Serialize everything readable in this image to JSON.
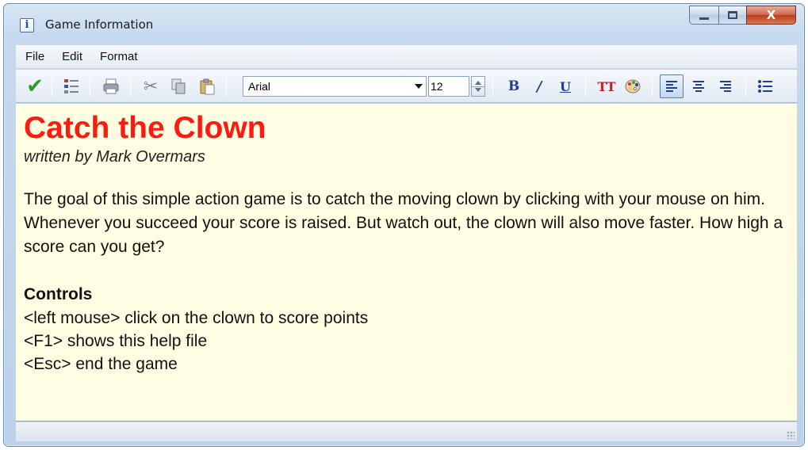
{
  "window": {
    "title": "Game Information",
    "controls": {
      "minimize": "minimize",
      "maximize": "maximize",
      "close": "X"
    }
  },
  "menubar": {
    "items": [
      "File",
      "Edit",
      "Format"
    ]
  },
  "toolbar": {
    "font_name": "Arial",
    "font_size": "12",
    "icons": [
      "check-icon",
      "list-icon",
      "print-icon",
      "cut-icon",
      "copy-icon",
      "paste-icon",
      "bold-icon",
      "italic-icon",
      "underline-icon",
      "font-size-icon",
      "color-palette-icon",
      "align-left-icon",
      "align-center-icon",
      "align-right-icon",
      "bullet-list-icon"
    ],
    "bold_label": "B",
    "italic_label": "/",
    "underline_label": "U",
    "font_size_label": "TT"
  },
  "document": {
    "title": "Catch the Clown",
    "author": "written by Mark Overmars",
    "description": "The goal of this simple action game is to catch the moving clown by clicking with your mouse on him. Whenever you succeed your score is raised. But watch out, the clown will also move faster. How high a score can you get?",
    "controls_heading": "Controls",
    "controls": [
      "<left mouse> click on the clown to score points",
      "<F1> shows this help file",
      "<Esc> end the game"
    ]
  },
  "colors": {
    "title_red": "#ff1a10",
    "editor_background": "#fffee2",
    "accent_blue": "#1f3f8f"
  }
}
